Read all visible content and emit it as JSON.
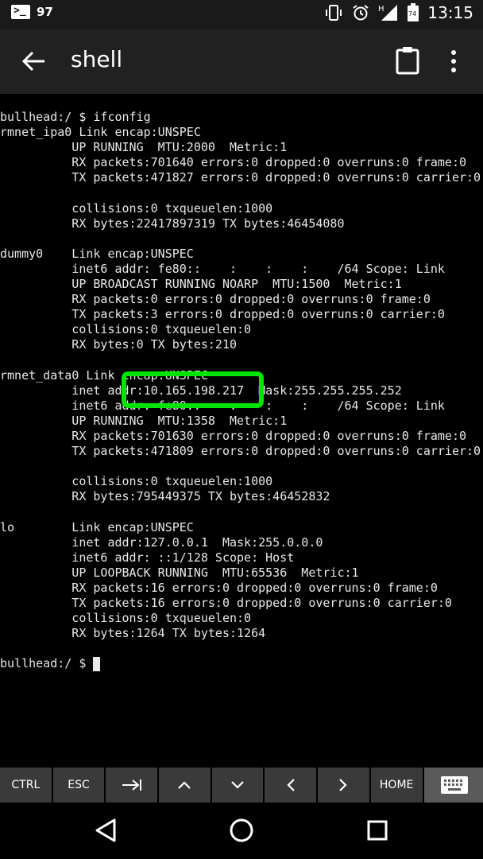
{
  "status_bar": {
    "count": "97",
    "time": "13:15",
    "network": "H",
    "battery": "74"
  },
  "app_bar": {
    "title": "shell"
  },
  "terminal": {
    "lines": [
      "bullhead:/ $ ifconfig",
      "rmnet_ipa0 Link encap:UNSPEC",
      "          UP RUNNING  MTU:2000  Metric:1",
      "          RX packets:701640 errors:0 dropped:0 overruns:0 frame:0",
      "          TX packets:471827 errors:0 dropped:0 overruns:0 carrier:0",
      "",
      "          collisions:0 txqueuelen:1000",
      "          RX bytes:22417897319 TX bytes:46454080",
      "",
      "dummy0    Link encap:UNSPEC",
      "          inet6 addr: fe80::    :    :    :    /64 Scope: Link",
      "          UP BROADCAST RUNNING NOARP  MTU:1500  Metric:1",
      "          RX packets:0 errors:0 dropped:0 overruns:0 frame:0",
      "          TX packets:3 errors:0 dropped:0 overruns:0 carrier:0",
      "          collisions:0 txqueuelen:0",
      "          RX bytes:0 TX bytes:210",
      "",
      "rmnet_data0 Link encap:UNSPEC",
      "          inet addr:10.165.198.217  Mask:255.255.255.252",
      "          inet6 addr: fe80::    :    :    :    /64 Scope: Link",
      "          UP RUNNING  MTU:1358  Metric:1",
      "          RX packets:701630 errors:0 dropped:0 overruns:0 frame:0",
      "          TX packets:471809 errors:0 dropped:0 overruns:0 carrier:0",
      "",
      "          collisions:0 txqueuelen:1000",
      "          RX bytes:795449375 TX bytes:46452832",
      "",
      "lo        Link encap:UNSPEC",
      "          inet addr:127.0.0.1  Mask:255.0.0.0",
      "          inet6 addr: ::1/128 Scope: Host",
      "          UP LOOPBACK RUNNING  MTU:65536  Metric:1",
      "          RX packets:16 errors:0 dropped:0 overruns:0 frame:0",
      "          TX packets:16 errors:0 dropped:0 overruns:0 carrier:0",
      "          collisions:0 txqueuelen:0",
      "          RX bytes:1264 TX bytes:1264",
      ""
    ],
    "prompt": "bullhead:/ $"
  },
  "extra_keys": {
    "ctrl": "CTRL",
    "esc": "ESC",
    "tab": "⇥",
    "up": "⌃",
    "down": "⌄",
    "left": "‹",
    "right": "›",
    "home": "HOME"
  },
  "colors": {
    "highlight": "#00e500",
    "app_bar": "#212121",
    "key_bg": "#3a3a3a"
  }
}
